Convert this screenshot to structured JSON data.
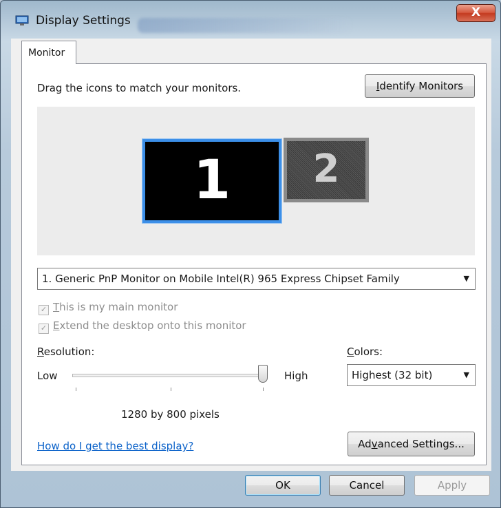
{
  "window": {
    "title": "Display Settings",
    "close_label": "X"
  },
  "tabs": [
    {
      "label": "Monitor"
    }
  ],
  "monitor_tab": {
    "drag_label": "Drag the icons to match your monitors.",
    "identify_button": {
      "prefix": "",
      "mnemonic": "I",
      "rest": "dentify Monitors"
    },
    "monitors": [
      {
        "number": "1",
        "selected": true
      },
      {
        "number": "2",
        "selected": false
      }
    ],
    "monitor_select": {
      "value": "1. Generic PnP Monitor on Mobile Intel(R) 965 Express Chipset Family"
    },
    "main_monitor_checkbox": {
      "mnemonic": "T",
      "rest": "his is my main monitor",
      "checked": true,
      "enabled": false
    },
    "extend_checkbox": {
      "mnemonic": "E",
      "rest": "xtend the desktop onto this monitor",
      "checked": true,
      "enabled": false
    },
    "resolution": {
      "label_mnemonic": "R",
      "label_rest": "esolution:",
      "low_label": "Low",
      "high_label": "High",
      "slider_level_percent": 100,
      "value_text": "1280 by 800 pixels"
    },
    "colors": {
      "label_mnemonic": "C",
      "label_rest": "olors:",
      "value": "Highest (32 bit)"
    },
    "help_link": "How do I get the best display?",
    "advanced_button": {
      "prefix": "Ad",
      "mnemonic": "v",
      "rest": "anced Settings..."
    }
  },
  "footer": {
    "ok_label": "OK",
    "cancel_label": "Cancel",
    "apply_label": "Apply"
  },
  "colors_theme": {
    "accent": "#3c8fe8",
    "link": "#0b62c9",
    "close": "#c33a1f"
  }
}
